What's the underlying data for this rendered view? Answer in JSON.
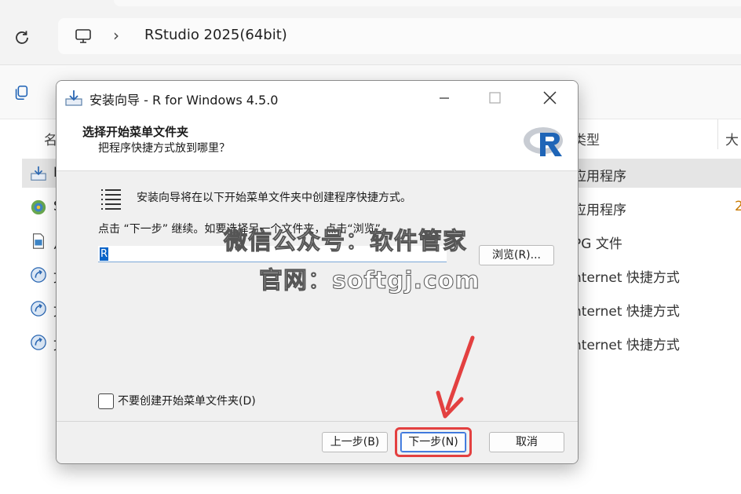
{
  "explorer": {
    "breadcrumb": "RStudio 2025(64bit)",
    "headers": {
      "name": "名",
      "type": "类型",
      "size": "大"
    },
    "rows": [
      {
        "name_initial": "R",
        "type": "应用程序",
        "size": "",
        "icon": "installer-icon"
      },
      {
        "name_initial": "S",
        "type": "应用程序",
        "size": "2",
        "icon": "rstudio-setup-icon"
      },
      {
        "name_initial": "从",
        "type": "PG 文件",
        "size": "",
        "icon": "image-file-icon"
      },
      {
        "name_initial": "文",
        "type": "nternet 快捷方式",
        "size": "",
        "icon": "internet-shortcut-icon"
      },
      {
        "name_initial": "文",
        "type": "nternet 快捷方式",
        "size": "",
        "icon": "internet-shortcut-icon"
      },
      {
        "name_initial": "文",
        "type": "nternet 快捷方式",
        "size": "",
        "icon": "internet-shortcut-icon"
      }
    ]
  },
  "dialog": {
    "title": "安装向导 - R for Windows 4.5.0",
    "header_title": "选择开始菜单文件夹",
    "header_subtitle": "把程序快捷方式放到哪里？",
    "intro": "安装向导将在以下开始菜单文件夹中创建程序快捷方式。",
    "continue_text": "点击 “下一步” 继续。如要选择另一个文件夹，点击“浏览”。",
    "folder_value": "R",
    "browse_label": "浏览(R)...",
    "checkbox_label": "不要创建开始菜单文件夹(D)",
    "back_label": "上一步(B)",
    "next_label": "下一步(N)",
    "cancel_label": "取消"
  },
  "watermark": {
    "line1": "微信公众号：软件管家",
    "line2": "官网：softgj.com"
  },
  "colors": {
    "accent": "#2f6bd8",
    "highlight": "#e34040",
    "r_logo_blue": "#1f65b7"
  }
}
